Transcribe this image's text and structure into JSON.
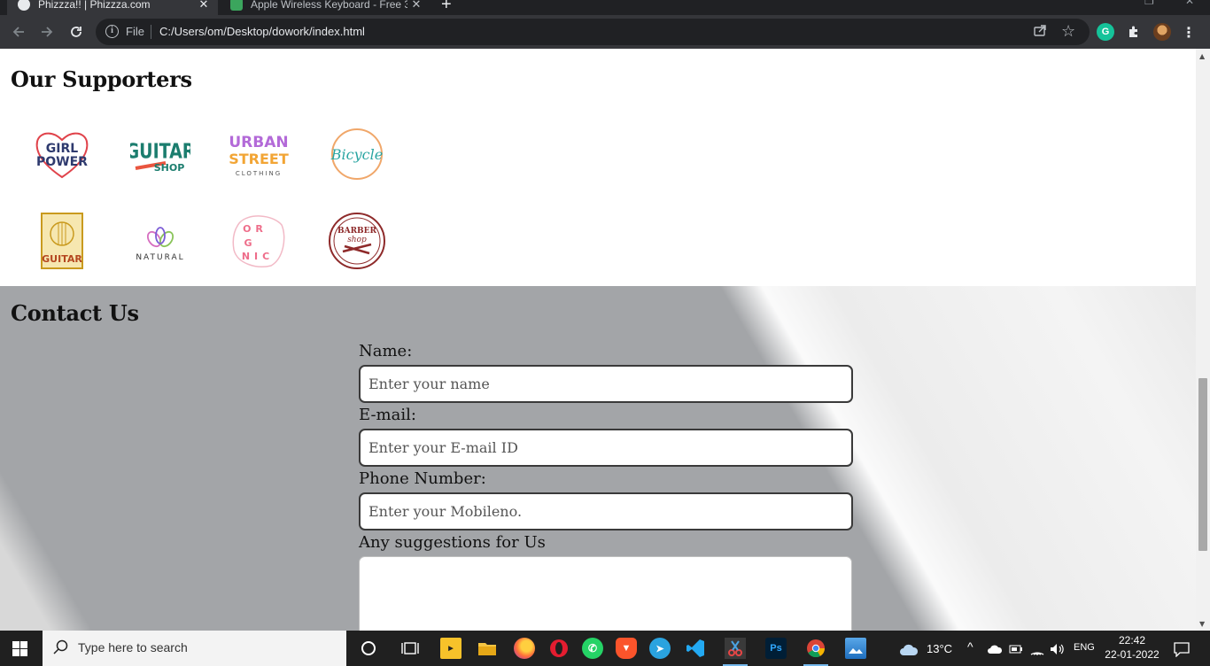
{
  "browser": {
    "tabs": [
      {
        "title": "Phizzza!! | Phizzza.com",
        "active": true
      },
      {
        "title": "Apple Wireless Keyboard - Free 3",
        "active": false
      }
    ],
    "address": {
      "scheme_label": "File",
      "url": "C:/Users/om/Desktop/dowork/index.html"
    }
  },
  "page": {
    "supporters": {
      "heading": "Our Supporters",
      "logos": [
        {
          "name": "girl-power-logo",
          "line1": "GIRL",
          "line2": "POWER"
        },
        {
          "name": "guitar-shop-logo",
          "line1": "GUITAR",
          "line2": "SHOP"
        },
        {
          "name": "urban-street-logo",
          "line1": "URBAN",
          "line2": "STREET",
          "line3": "CLOTHING"
        },
        {
          "name": "bicycle-logo",
          "line1": "Bicycle"
        },
        {
          "name": "guitar-badge-logo",
          "line1": "GUITAR"
        },
        {
          "name": "natural-logo",
          "line1": "NATURAL"
        },
        {
          "name": "organic-logo",
          "line1": "OR",
          "line2": "G",
          "line3": "NIC"
        },
        {
          "name": "barber-shop-logo",
          "line1": "BARBER",
          "line2": "shop"
        }
      ]
    },
    "contact": {
      "heading": "Contact Us",
      "name_label": "Name:",
      "name_placeholder": "Enter your name",
      "email_label": "E-mail:",
      "email_placeholder": "Enter your E-mail ID",
      "phone_label": "Phone Number:",
      "phone_placeholder": "Enter your Mobileno.",
      "suggestions_label": "Any suggestions for Us"
    }
  },
  "taskbar": {
    "search_placeholder": "Type here to search",
    "weather": "13°C",
    "language": "ENG",
    "time": "22:42",
    "date": "22-01-2022"
  }
}
